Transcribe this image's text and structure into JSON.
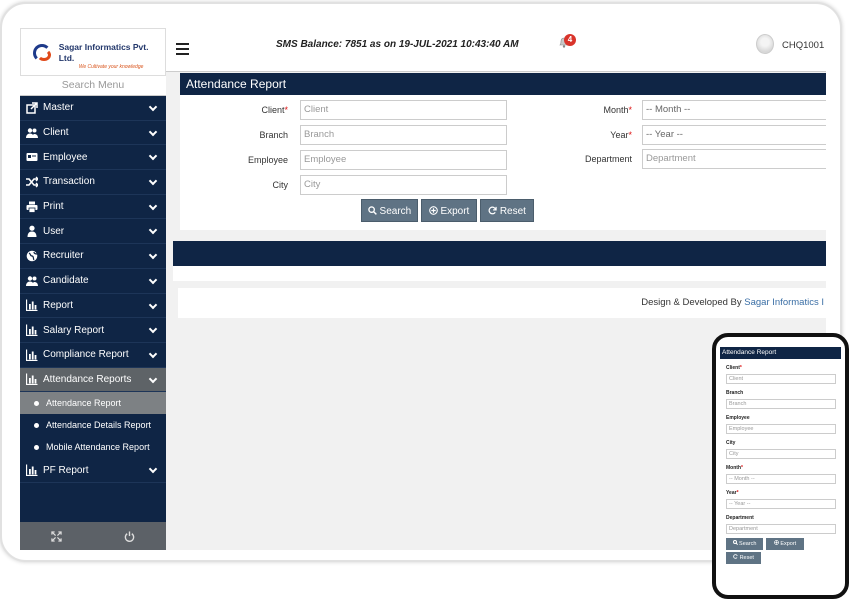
{
  "brand": {
    "company": "Sagar Informatics Pvt. Ltd.",
    "tagline": "We Cultivate your knowledge"
  },
  "sidebar": {
    "search_placeholder": "Search Menu",
    "items": [
      {
        "label": "Master",
        "icon": "external-link-icon"
      },
      {
        "label": "Client",
        "icon": "users-icon"
      },
      {
        "label": "Employee",
        "icon": "credit-card-icon"
      },
      {
        "label": "Transaction",
        "icon": "shuffle-icon"
      },
      {
        "label": "Print",
        "icon": "print-icon"
      },
      {
        "label": "User",
        "icon": "user-icon"
      },
      {
        "label": "Recruiter",
        "icon": "globe-icon"
      },
      {
        "label": "Candidate",
        "icon": "users-icon"
      },
      {
        "label": "Report",
        "icon": "bar-chart-icon"
      },
      {
        "label": "Salary Report",
        "icon": "bar-chart-icon"
      },
      {
        "label": "Compliance Report",
        "icon": "bar-chart-icon"
      },
      {
        "label": "Attendance Reports",
        "icon": "bar-chart-icon"
      }
    ],
    "sub_items": [
      {
        "label": "Attendance Report"
      },
      {
        "label": "Attendance Details Report"
      },
      {
        "label": "Mobile Attendance Report"
      }
    ],
    "last_item": {
      "label": "PF Report",
      "icon": "bar-chart-icon"
    }
  },
  "header": {
    "sms_balance": "SMS Balance: 7851 as on 19-JUL-2021 10:43:40 AM",
    "notification_count": "4",
    "user_code": "CHQ1001 ["
  },
  "form": {
    "title": "Attendance Report",
    "client_label": "Client",
    "client_placeholder": "Client",
    "branch_label": "Branch",
    "branch_placeholder": "Branch",
    "employee_label": "Employee",
    "employee_placeholder": "Employee",
    "city_label": "City",
    "city_placeholder": "City",
    "month_label": "Month",
    "month_value": "-- Month --",
    "year_label": "Year",
    "year_value": "-- Year --",
    "department_label": "Department",
    "department_placeholder": "Department",
    "required_mark": "*",
    "search_label": "Search",
    "export_label": "Export",
    "reset_label": "Reset"
  },
  "footer": {
    "credit_prefix": "Design & Developed By ",
    "credit_brand": "Sagar Informatics I"
  },
  "colors": {
    "navy": "#0f2545",
    "button": "#5f7384",
    "badge": "#d9342b"
  }
}
